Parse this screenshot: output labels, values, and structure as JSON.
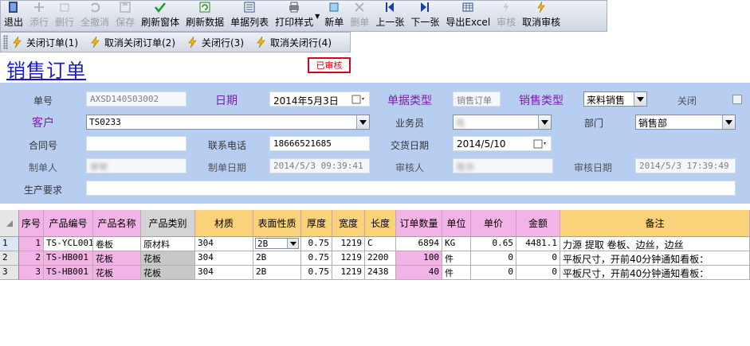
{
  "toolbar": {
    "items": [
      {
        "label": "退出",
        "icon": "exit-icon",
        "enabled": true
      },
      {
        "label": "添行",
        "icon": "add-row-icon",
        "enabled": false
      },
      {
        "label": "删行",
        "icon": "delete-row-icon",
        "enabled": false
      },
      {
        "label": "全撤消",
        "icon": "undo-icon",
        "enabled": false
      },
      {
        "label": "保存",
        "icon": "save-icon",
        "enabled": false
      },
      {
        "label": "刷新窗体",
        "icon": "check-icon",
        "enabled": true
      },
      {
        "label": "刷新数据",
        "icon": "refresh-icon",
        "enabled": true
      },
      {
        "label": "单据列表",
        "icon": "list-icon",
        "enabled": true
      },
      {
        "label": "打印样式",
        "icon": "printer-icon",
        "enabled": true
      },
      {
        "label": "新单",
        "icon": "new-doc-icon",
        "enabled": true
      },
      {
        "label": "删单",
        "icon": "delete-doc-icon",
        "enabled": false
      },
      {
        "label": "上一张",
        "icon": "prev-icon",
        "enabled": true
      },
      {
        "label": "下一张",
        "icon": "next-icon",
        "enabled": true
      },
      {
        "label": "导出Excel",
        "icon": "excel-icon",
        "enabled": true
      },
      {
        "label": "审核",
        "icon": "approve-icon",
        "enabled": false
      },
      {
        "label": "取消审核",
        "icon": "cancel-approve-icon",
        "enabled": true
      }
    ]
  },
  "filters": {
    "close_order": "关闭订单(1)",
    "cancel_close_order": "取消关闭订单(2)",
    "close_line": "关闭行(3)",
    "cancel_close_line": "取消关闭行(4)"
  },
  "page": {
    "title": "销售订单",
    "status": "已审核"
  },
  "form": {
    "order_no_label": "单号",
    "order_no": "AXSD140503002",
    "date_label": "日期",
    "date": "2014年5月3日",
    "doc_type_label": "单据类型",
    "doc_type": "销售订单",
    "sales_type_label": "销售类型",
    "sales_type": "来料销售",
    "closed_label": "关闭",
    "customer_label": "客户",
    "customer": "TS0233",
    "salesman_label": "业务员",
    "salesman": "陈",
    "dept_label": "部门",
    "dept": "销售部",
    "contract_label": "合同号",
    "contract": "",
    "phone_label": "联系电话",
    "phone": "18666521685",
    "delivery_label": "交货日期",
    "delivery": "2014/5/10",
    "maker_label": "制单人",
    "maker": "李琴",
    "make_date_label": "制单日期",
    "make_date": "2014/5/3 09:39:41",
    "auditor_label": "审核人",
    "auditor": "陈华",
    "audit_date_label": "审核日期",
    "audit_date": "2014/5/3 17:39:49",
    "requirement_label": "生产要求",
    "requirement": ""
  },
  "grid": {
    "columns": [
      "序号",
      "产品编号",
      "产品名称",
      "产品类别",
      "材质",
      "表面性质",
      "厚度",
      "宽度",
      "长度",
      "订单数量",
      "单位",
      "单价",
      "金额",
      "备注"
    ],
    "rows": [
      {
        "rowhdr": "1",
        "seq": "1",
        "code": "TS-YCL001",
        "name": "卷板",
        "category": "原材料",
        "material": "304",
        "surface": "2B",
        "thickness": "0.75",
        "width": "1219",
        "length": "C",
        "qty": "6894",
        "unit": "KG",
        "price": "0.65",
        "amount": "4481.1",
        "remark": "力源 提取 卷板、边丝，边丝"
      },
      {
        "rowhdr": "2",
        "seq": "2",
        "code": "TS-HB001",
        "name": "花板",
        "category": "花板",
        "material": "304",
        "surface": "2B",
        "thickness": "0.75",
        "width": "1219",
        "length": "2200",
        "qty": "100",
        "unit": "件",
        "price": "0",
        "amount": "0",
        "remark": "平板尺寸，开前40分钟通知看板："
      },
      {
        "rowhdr": "3",
        "seq": "3",
        "code": "TS-HB001",
        "name": "花板",
        "category": "花板",
        "material": "304",
        "surface": "2B",
        "thickness": "0.75",
        "width": "1219",
        "length": "2438",
        "qty": "40",
        "unit": "件",
        "price": "0",
        "amount": "0",
        "remark": "平板尺寸，开前40分钟通知看板："
      }
    ]
  },
  "colors": {
    "form_bg": "#b8cef0",
    "title": "#1a1ad0",
    "status": "#e0001a",
    "header_pink": "#f2b4e6",
    "header_orange": "#f9d27a"
  }
}
